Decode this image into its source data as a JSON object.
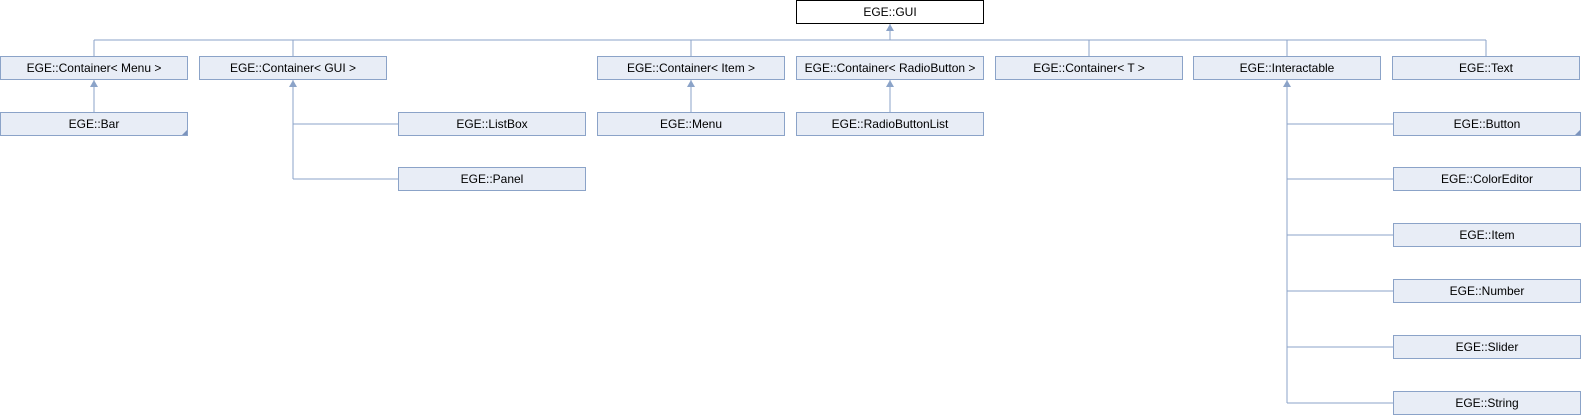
{
  "diagram": {
    "root": {
      "label": "EGE::GUI"
    },
    "level1": [
      {
        "label": "EGE::Container< Menu >"
      },
      {
        "label": "EGE::Container< GUI >"
      },
      {
        "label": "EGE::Container< Item >"
      },
      {
        "label": "EGE::Container< RadioButton >"
      },
      {
        "label": "EGE::Container< T >"
      },
      {
        "label": "EGE::Interactable"
      },
      {
        "label": "EGE::Text"
      }
    ],
    "level2": {
      "bar": {
        "label": "EGE::Bar",
        "has_more": true
      },
      "listbox": {
        "label": "EGE::ListBox"
      },
      "panel": {
        "label": "EGE::Panel"
      },
      "menu": {
        "label": "EGE::Menu"
      },
      "radio_button_list": {
        "label": "EGE::RadioButtonList"
      },
      "button": {
        "label": "EGE::Button",
        "has_more": true
      },
      "color_editor": {
        "label": "EGE::ColorEditor"
      },
      "item": {
        "label": "EGE::Item"
      },
      "number": {
        "label": "EGE::Number"
      },
      "slider": {
        "label": "EGE::Slider"
      },
      "string": {
        "label": "EGE::String"
      }
    }
  }
}
